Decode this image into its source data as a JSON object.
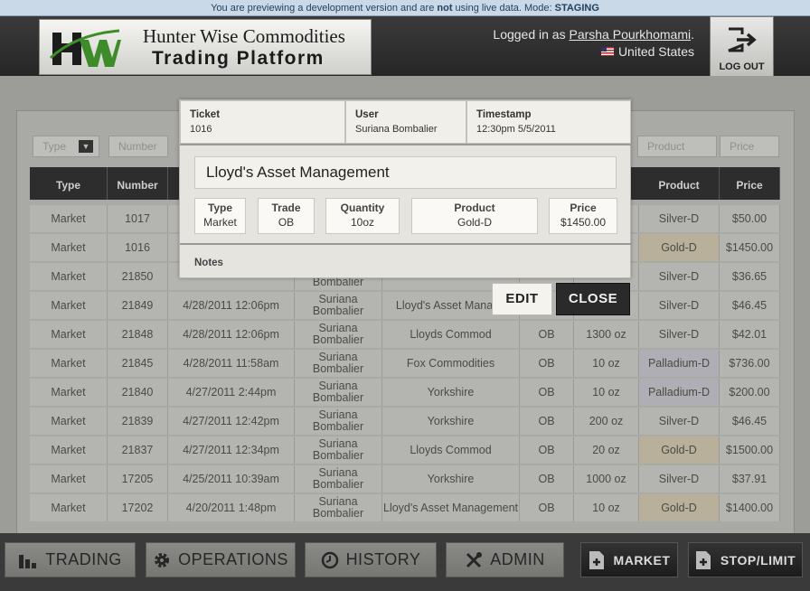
{
  "banner": {
    "prefix": "You are previewing a development version and are ",
    "emph": "not",
    "suffix": " using live data. Mode: ",
    "mode": "STAGING"
  },
  "header": {
    "brand_line1": "Hunter Wise Commodities",
    "brand_line2": "Trading Platform",
    "logged_in_prefix": "Logged in as",
    "user": "Parsha Pourkhomami",
    "country": "United States",
    "logout_label": "LOG OUT"
  },
  "filters": [
    "Type",
    "Number",
    "Product",
    "Price"
  ],
  "table": {
    "columns": [
      "Type",
      "Number",
      "Product",
      "Price"
    ],
    "rows": [
      {
        "type": "Market",
        "number": "1017",
        "time": "",
        "user": "",
        "client": "",
        "trade": "",
        "qty": "",
        "product": "Silver-D",
        "price": "$50.00",
        "hl": ""
      },
      {
        "type": "Market",
        "number": "1016",
        "time": "",
        "user": "",
        "client": "",
        "trade": "",
        "qty": "",
        "product": "Gold-D",
        "price": "$1450.00",
        "hl": "gold"
      },
      {
        "type": "Market",
        "number": "21850",
        "time": "",
        "user": "Suriana Bombalier",
        "client": "",
        "trade": "",
        "qty": "",
        "product": "Silver-D",
        "price": "$36.65",
        "hl": ""
      },
      {
        "type": "Market",
        "number": "21849",
        "time": "4/28/2011 12:06pm",
        "user": "Suriana Bombalier",
        "client": "Lloyd's Asset Manage",
        "trade": "",
        "qty": "",
        "product": "Silver-D",
        "price": "$46.45",
        "hl": ""
      },
      {
        "type": "Market",
        "number": "21848",
        "time": "4/28/2011 12:06pm",
        "user": "Suriana Bombalier",
        "client": "Lloyds Commod",
        "trade": "OB",
        "qty": "1300 oz",
        "product": "Silver-D",
        "price": "$42.01",
        "hl": ""
      },
      {
        "type": "Market",
        "number": "21845",
        "time": "4/28/2011 11:58am",
        "user": "Suriana Bombalier",
        "client": "Fox Commodities",
        "trade": "OB",
        "qty": "10 oz",
        "product": "Palladium-D",
        "price": "$736.00",
        "hl": "pal"
      },
      {
        "type": "Market",
        "number": "21840",
        "time": "4/27/2011 2:44pm",
        "user": "Suriana Bombalier",
        "client": "Yorkshire",
        "trade": "OB",
        "qty": "10 oz",
        "product": "Palladium-D",
        "price": "$200.00",
        "hl": "pal"
      },
      {
        "type": "Market",
        "number": "21839",
        "time": "4/27/2011 12:42pm",
        "user": "Suriana Bombalier",
        "client": "Yorkshire",
        "trade": "OB",
        "qty": "200 oz",
        "product": "Silver-D",
        "price": "$46.45",
        "hl": ""
      },
      {
        "type": "Market",
        "number": "21837",
        "time": "4/27/2011 12:34pm",
        "user": "Suriana Bombalier",
        "client": "Lloyds Commod",
        "trade": "OB",
        "qty": "20 oz",
        "product": "Gold-D",
        "price": "$1500.00",
        "hl": "gold"
      },
      {
        "type": "Market",
        "number": "17205",
        "time": "4/25/2011 10:39am",
        "user": "Suriana Bombalier",
        "client": "Yorkshire",
        "trade": "OB",
        "qty": "1000 oz",
        "product": "Silver-D",
        "price": "$37.91",
        "hl": ""
      },
      {
        "type": "Market",
        "number": "17202",
        "time": "4/20/2011 1:48pm",
        "user": "Suriana Bombalier",
        "client": "Lloyd's Asset Management",
        "trade": "OB",
        "qty": "10 oz",
        "product": "Gold-D",
        "price": "$1400.00",
        "hl": "gold"
      }
    ]
  },
  "modal": {
    "ticket_label": "Ticket",
    "ticket": "1016",
    "user_label": "User",
    "user": "Suriana Bombalier",
    "timestamp_label": "Timestamp",
    "timestamp": "12:30pm 5/5/2011",
    "client": "Lloyd's Asset Management",
    "type_label": "Type",
    "type": "Market",
    "trade_label": "Trade",
    "trade": "OB",
    "quantity_label": "Quantity",
    "quantity": "10oz",
    "product_label": "Product",
    "product": "Gold-D",
    "price_label": "Price",
    "price": "$1450.00",
    "notes_label": "Notes",
    "edit_label": "EDIT",
    "close_label": "CLOSE"
  },
  "footer": {
    "trading": "TRADING",
    "operations": "OPERATIONS",
    "history": "HISTORY",
    "admin": "ADMIN",
    "market": "MARKET",
    "stop_limit": "STOP/LIMIT"
  }
}
